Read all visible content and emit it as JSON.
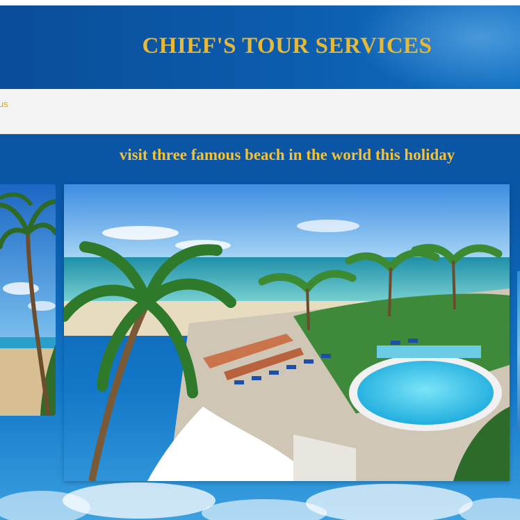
{
  "site": {
    "title": "CHIEF'S TOUR SERVICES"
  },
  "nav": {
    "link_label": "us"
  },
  "main": {
    "headline": "visit three famous beach in the world this holiday"
  },
  "colors": {
    "title": "#e6b93a",
    "headline": "#f2c23a",
    "nav_link": "#d4a62a",
    "background": "#0b4f9a"
  }
}
